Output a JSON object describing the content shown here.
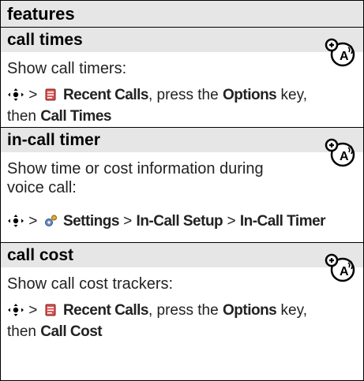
{
  "header": {
    "title": "features"
  },
  "features": [
    {
      "heading": "call times",
      "description": "Show call timers:",
      "path_part1": "Recent Calls",
      "path_text1": ", press the ",
      "path_part2": "Options",
      "path_text2": " key,",
      "path_line2_text": "then ",
      "path_part3": "Call Times",
      "icon": "network-feature-icon"
    },
    {
      "heading": "in-call timer",
      "description_line1": "Show time or cost information during",
      "description_line2": "voice call:",
      "path_part1": "Settings",
      "path_sep1": " > ",
      "path_part2": "In-Call Setup",
      "path_sep2": " > ",
      "path_part3": "In-Call Timer",
      "icon": "network-feature-icon"
    },
    {
      "heading": "call cost",
      "description": "Show call cost trackers:",
      "path_part1": "Recent Calls",
      "path_text1": ", press the ",
      "path_part2": "Options",
      "path_text2": " key,",
      "path_line2_text": "then ",
      "path_part3": "Call Cost",
      "icon": "network-feature-icon"
    }
  ],
  "nav_separator": " > ",
  "colors": {
    "heading_bg": "#e6e6e6",
    "border": "#000000"
  }
}
